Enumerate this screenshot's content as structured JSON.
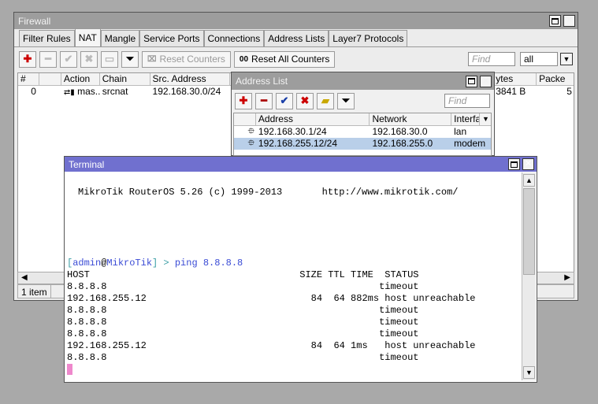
{
  "firewall": {
    "title": "Firewall",
    "tabs": [
      "Filter Rules",
      "NAT",
      "Mangle",
      "Service Ports",
      "Connections",
      "Address Lists",
      "Layer7 Protocols"
    ],
    "active_tab": "NAT",
    "toolbar": {
      "reset_counters": "Reset Counters",
      "reset_all_counters": "Reset All Counters",
      "reset_all_mark": "00",
      "find_placeholder": "Find",
      "filter_value": "all"
    },
    "columns": [
      "#",
      "Action",
      "Chain",
      "Src. Address",
      "ytes",
      "Packe"
    ],
    "rows": [
      {
        "num": "0",
        "action": "mas...",
        "chain": "srcnat",
        "src": "192.168.30.0/24",
        "bytes": "3841 B",
        "packets": "5"
      }
    ],
    "status": "1 item"
  },
  "address_list": {
    "title": "Address List",
    "find_placeholder": "Find",
    "columns": [
      "Address",
      "Network",
      "Interfac"
    ],
    "rows": [
      {
        "address": "192.168.30.1/24",
        "network": "192.168.30.0",
        "interface": "lan",
        "selected": false
      },
      {
        "address": "192.168.255.12/24",
        "network": "192.168.255.0",
        "interface": "modem",
        "selected": true
      }
    ]
  },
  "terminal": {
    "title": "Terminal",
    "banner": "MikroTik RouterOS 5.26 (c) 1999-2013       http://www.mikrotik.com/",
    "prompt_open": "[",
    "prompt_user": "admin",
    "prompt_at": "@",
    "prompt_host": "MikroTik",
    "prompt_close": "] > ",
    "command": "ping 8.8.8.8",
    "lines": [
      "HOST                                     SIZE TTL TIME  STATUS",
      "8.8.8.8                                                timeout",
      "192.168.255.12                             84  64 882ms host unreachable",
      "8.8.8.8                                                timeout",
      "8.8.8.8                                                timeout",
      "8.8.8.8                                                timeout",
      "192.168.255.12                             84  64 1ms   host unreachable",
      "8.8.8.8                                                timeout"
    ]
  },
  "colors": {
    "terminal_titlebar": "#7070cf",
    "inactive_titlebar": "#9d9d9d",
    "selection": "#b9cfe9",
    "cursor": "#ee88cc"
  }
}
